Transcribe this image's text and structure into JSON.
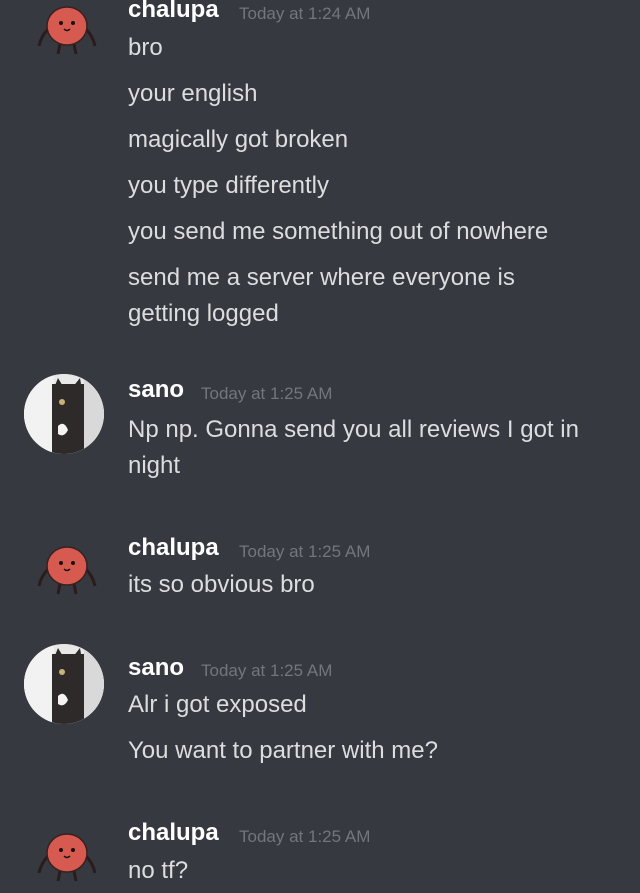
{
  "theme": {
    "background": "#36393f",
    "username_color": "#ffffff",
    "timestamp_color": "#72767d",
    "text_color": "#dcddde",
    "chalupa_avatar_color": "#d65a50"
  },
  "messages": [
    {
      "author": "chalupa",
      "avatar_icon": "red-blob-avatar",
      "timestamp": "Today at 1:24 AM",
      "lines": [
        "bro",
        "your english",
        "magically got broken",
        "you type differently",
        "you send me something out of nowhere",
        "send me a server where everyone is getting logged"
      ]
    },
    {
      "author": "sano",
      "avatar_icon": "cat-photo-avatar",
      "timestamp": "Today at 1:25 AM",
      "lines": [
        "Np np. Gonna send you all reviews I got in night"
      ]
    },
    {
      "author": "chalupa",
      "avatar_icon": "red-blob-avatar",
      "timestamp": "Today at 1:25 AM",
      "lines": [
        "its so obvious bro"
      ]
    },
    {
      "author": "sano",
      "avatar_icon": "cat-photo-avatar",
      "timestamp": "Today at 1:25 AM",
      "lines": [
        "Alr i got exposed",
        "You want to partner with me?"
      ]
    },
    {
      "author": "chalupa",
      "avatar_icon": "red-blob-avatar",
      "timestamp": "Today at 1:25 AM",
      "lines": [
        "no tf?"
      ]
    }
  ]
}
